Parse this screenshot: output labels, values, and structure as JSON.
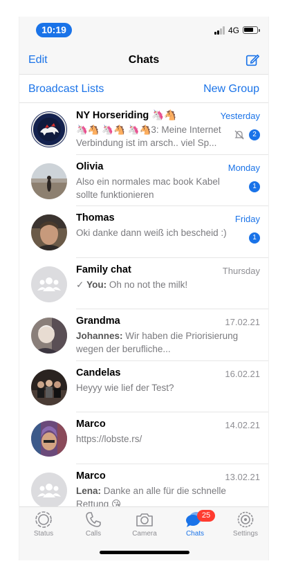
{
  "status_bar": {
    "time": "10:19",
    "network": "4G"
  },
  "header": {
    "edit_label": "Edit",
    "title": "Chats"
  },
  "subheader": {
    "left_label": "Broadcast Lists",
    "right_label": "New Group"
  },
  "chats": [
    {
      "name": "NY Horseriding",
      "name_emoji": "🦄🐴",
      "date": "Yesterday",
      "date_accent": true,
      "preview": "🦄🐴 🦄🐴 🦄🐴3: Meine Internet Verbindung ist im arsch.. viel Sp...",
      "unread": "2",
      "muted": true
    },
    {
      "name": "Olivia",
      "date": "Monday",
      "date_accent": true,
      "preview": "Also ein normales mac book Kabel sollte funktionieren",
      "unread": "1"
    },
    {
      "name": "Thomas",
      "date": "Friday",
      "date_accent": true,
      "preview": "Oki danke dann weiß ich bescheid :)",
      "unread": "1"
    },
    {
      "name": "Family chat",
      "date": "Thursday",
      "sender": "You:",
      "preview": "Oh no not the milk!",
      "check": "✓"
    },
    {
      "name": "Grandma",
      "date": "17.02.21",
      "sender": "Johannes:",
      "preview": "Wir haben die Priorisierung wegen der berufliche..."
    },
    {
      "name": "Candelas",
      "date": "16.02.21",
      "preview": "Heyyy wie lief der Test?"
    },
    {
      "name": "Marco",
      "date": "14.02.21",
      "preview": "https://lobste.rs/"
    },
    {
      "name": "Marco",
      "date": "13.02.21",
      "sender": "Lena:",
      "preview": "Danke an alle für die schnelle Rettung 😘"
    }
  ],
  "tabs": [
    {
      "label": "Status",
      "icon": "status-icon"
    },
    {
      "label": "Calls",
      "icon": "phone-icon"
    },
    {
      "label": "Camera",
      "icon": "camera-icon"
    },
    {
      "label": "Chats",
      "icon": "chats-icon",
      "badge": "25",
      "active": true
    },
    {
      "label": "Settings",
      "icon": "gear-icon"
    }
  ],
  "colors": {
    "accent": "#1a73e8",
    "badge_red": "#ff3b30",
    "secondary_text": "#8e8e93"
  }
}
